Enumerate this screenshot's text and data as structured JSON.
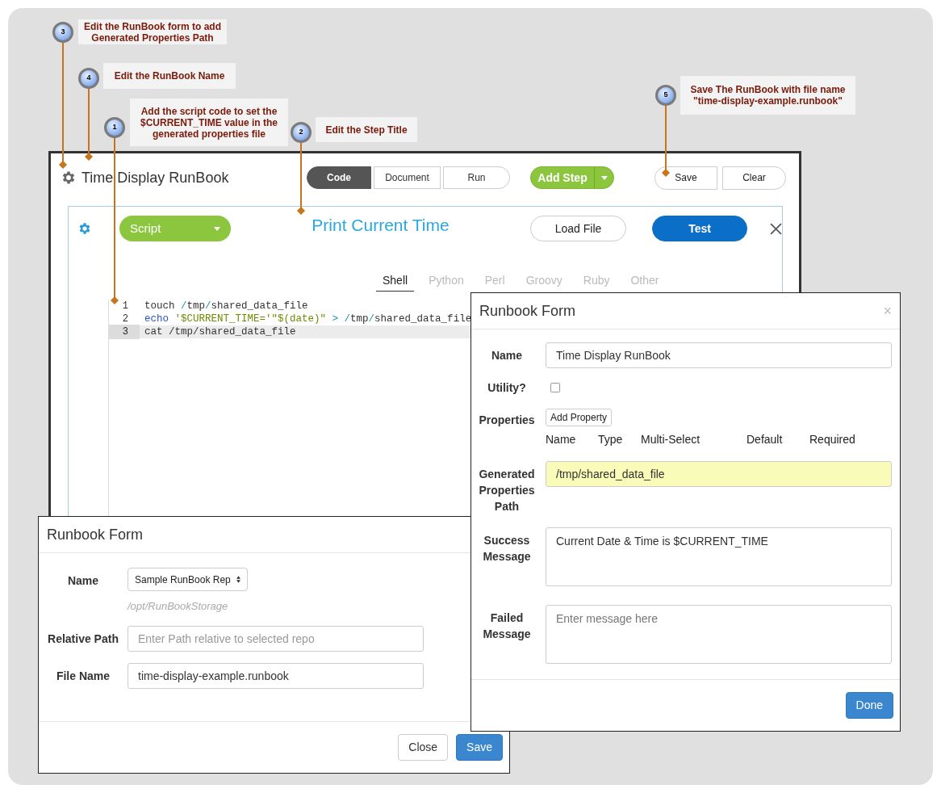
{
  "callouts": [
    {
      "number": "3",
      "text": "Edit the RunBook form to add Generated Properties Path"
    },
    {
      "number": "4",
      "text": "Edit the RunBook Name"
    },
    {
      "number": "1",
      "text": "Add the script code to set the $CURRENT_TIME value in the generated properties file"
    },
    {
      "number": "2",
      "text": "Edit the Step Title"
    },
    {
      "number": "5",
      "text": "Save The RunBook with file name \"time-display-example.runbook\""
    }
  ],
  "main_window": {
    "title": "Time Display RunBook",
    "mode_tabs": [
      {
        "label": "Code",
        "selected": true
      },
      {
        "label": "Document",
        "selected": false
      },
      {
        "label": "Run",
        "selected": false
      }
    ],
    "add_step": "Add Step",
    "buttons": [
      "Save",
      "Clear"
    ],
    "step": {
      "type": "Script",
      "title": "Print Current Time",
      "buttons": [
        {
          "label": "Load File",
          "kind": "outline"
        },
        {
          "label": "Test",
          "kind": "primary"
        }
      ],
      "language_tabs": [
        {
          "label": "Shell",
          "selected": true
        },
        {
          "label": "Python",
          "selected": false
        },
        {
          "label": "Perl",
          "selected": false
        },
        {
          "label": "Groovy",
          "selected": false
        },
        {
          "label": "Ruby",
          "selected": false
        },
        {
          "label": "Other",
          "selected": false
        }
      ],
      "code_lines": [
        {
          "number": "1",
          "highlighted": false,
          "tokens": [
            {
              "text": "touch ",
              "kind": "plain"
            },
            {
              "text": "/",
              "kind": "operator"
            },
            {
              "text": "tmp",
              "kind": "plain"
            },
            {
              "text": "/",
              "kind": "operator"
            },
            {
              "text": "shared_data_file",
              "kind": "plain"
            }
          ]
        },
        {
          "number": "2",
          "highlighted": false,
          "tokens": [
            {
              "text": "echo",
              "kind": "keyword"
            },
            {
              "text": "'$CURRENT_TIME='\"$(date)\"",
              "kind": "string",
              "space_before": true
            },
            {
              "text": ">",
              "kind": "operator",
              "space_before": true
            },
            {
              "text": "/",
              "kind": "operator",
              "space_before": true
            },
            {
              "text": "tmp",
              "kind": "plain"
            },
            {
              "text": "/",
              "kind": "operator"
            },
            {
              "text": "shared_data_file",
              "kind": "plain"
            }
          ]
        },
        {
          "number": "3",
          "highlighted": true,
          "tokens": [
            {
              "text": "cat /tmp/shared_data_file",
              "kind": "plain"
            }
          ]
        }
      ]
    }
  },
  "runbook_form": {
    "title": "Runbook Form",
    "close": "×",
    "fields": [
      {
        "kind": "text",
        "label": "Name",
        "value": "Time Display RunBook"
      },
      {
        "kind": "checkbox",
        "label": "Utility?",
        "checked": false
      },
      {
        "kind": "properties",
        "label": "Properties",
        "button": "Add Property",
        "columns": [
          "Name",
          "Type",
          "Multi-Select",
          "Default",
          "Required"
        ]
      },
      {
        "kind": "text",
        "label": "Generated Properties Path",
        "value": "/tmp/shared_data_file",
        "highlighted": true
      },
      {
        "kind": "textarea",
        "label": "Success Message",
        "value": "Current Date & Time is $CURRENT_TIME"
      },
      {
        "kind": "textarea",
        "label": "Failed Message",
        "placeholder": "Enter message here"
      }
    ],
    "buttons": [
      {
        "label": "Done",
        "kind": "primary"
      }
    ]
  },
  "save_form": {
    "title": "Runbook Form",
    "fields": [
      {
        "kind": "select",
        "label": "Name",
        "value": "Sample RunBook Rep",
        "hint": "/opt/RunBookStorage"
      },
      {
        "kind": "text",
        "label": "Relative Path",
        "placeholder": "Enter Path relative to selected repo"
      },
      {
        "kind": "text",
        "label": "File Name",
        "value": "time-display-example.runbook"
      }
    ],
    "buttons": [
      {
        "label": "Close",
        "kind": "default"
      },
      {
        "label": "Save",
        "kind": "primary"
      }
    ]
  }
}
